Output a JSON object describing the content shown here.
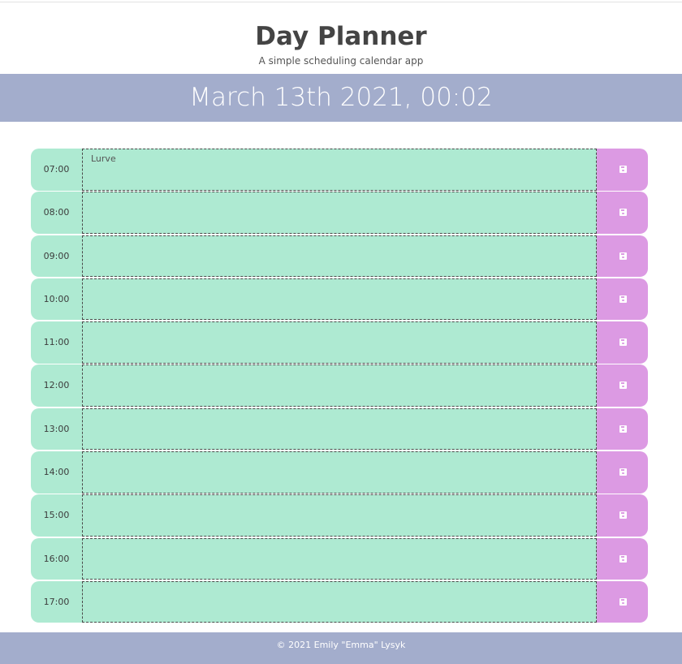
{
  "header": {
    "title": "Day Planner",
    "subtitle": "A simple scheduling calendar app"
  },
  "date_bar": {
    "current_date": "March 13th 2021, 00:02"
  },
  "schedule": [
    {
      "hour": "07:00",
      "event": "Lurve",
      "save_icon": "floppy-disk-icon"
    },
    {
      "hour": "08:00",
      "event": "",
      "save_icon": "floppy-disk-icon"
    },
    {
      "hour": "09:00",
      "event": "",
      "save_icon": "floppy-disk-icon"
    },
    {
      "hour": "10:00",
      "event": "",
      "save_icon": "floppy-disk-icon"
    },
    {
      "hour": "11:00",
      "event": "",
      "save_icon": "floppy-disk-icon"
    },
    {
      "hour": "12:00",
      "event": "",
      "save_icon": "floppy-disk-icon"
    },
    {
      "hour": "13:00",
      "event": "",
      "save_icon": "floppy-disk-icon"
    },
    {
      "hour": "14:00",
      "event": "",
      "save_icon": "floppy-disk-icon"
    },
    {
      "hour": "15:00",
      "event": "",
      "save_icon": "floppy-disk-icon"
    },
    {
      "hour": "16:00",
      "event": "",
      "save_icon": "floppy-disk-icon"
    },
    {
      "hour": "17:00",
      "event": "",
      "save_icon": "floppy-disk-icon"
    }
  ],
  "colors": {
    "banner": "#a3adcc",
    "future_row": "#aeead2",
    "save_button": "#dc9ae3"
  },
  "footer": {
    "text": "© 2021 Emily \"Emma\" Lysyk"
  }
}
